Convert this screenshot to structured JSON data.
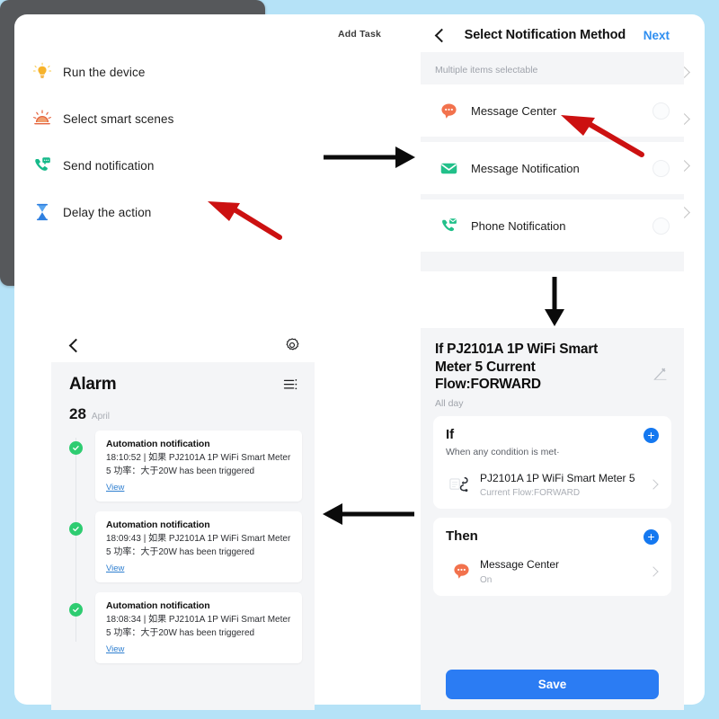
{
  "background_color": "#b5e2f7",
  "panel1": {
    "name": "Add Task",
    "title": "Add Task",
    "bezel_color": "#56585b",
    "items": [
      {
        "label": "Run the device",
        "icon": "lightbulb-icon",
        "color": "#f5a623"
      },
      {
        "label": "Select smart scenes",
        "icon": "sunrise-scene-icon",
        "color": "#ef6a4a"
      },
      {
        "label": "Send notification",
        "icon": "phone-message-icon",
        "color": "#16b98a"
      },
      {
        "label": "Delay the action",
        "icon": "hourglass-icon",
        "color": "#2f7fe0"
      }
    ]
  },
  "panel2": {
    "name": "Select Notification Method",
    "title": "Select Notification Method",
    "back_label": "back",
    "next_label": "Next",
    "subtitle": "Multiple items selectable",
    "methods": [
      {
        "label": "Message Center",
        "icon": "speech-bubble-icon",
        "color": "#f2724d",
        "selected": false
      },
      {
        "label": "Message Notification",
        "icon": "envelope-icon",
        "color": "#22c08a",
        "selected": false
      },
      {
        "label": "Phone Notification",
        "icon": "phone-envelope-icon",
        "color": "#22c08a",
        "selected": false
      }
    ]
  },
  "panel3": {
    "name": "Automation Detail",
    "title": "If PJ2101A 1P WiFi Smart Meter  5 Current Flow:FORWARD",
    "schedule": "All day",
    "edit_icon": "pencil-icon",
    "if_section": {
      "heading": "If",
      "subtitle": "When any condition is met·",
      "add_label": "+",
      "item": {
        "title": "PJ2101A 1P WiFi Smart Meter 5",
        "subtitle": "Current Flow:FORWARD",
        "icon": "smart-meter-icon"
      }
    },
    "then_section": {
      "heading": "Then",
      "add_label": "+",
      "item": {
        "title": "Message Center",
        "subtitle": "On",
        "icon": "speech-bubble-icon"
      }
    },
    "save_label": "Save",
    "save_color": "#2b7cf3"
  },
  "panel4": {
    "name": "Alarm",
    "back_label": "back",
    "settings_icon": "gear-icon",
    "title": "Alarm",
    "filter_icon": "list-filter-icon",
    "date_number": "28",
    "date_month": "April",
    "notifications": [
      {
        "title": "Automation notification",
        "body": "18:10:52 | 如果 PJ2101A 1P WiFi Smart Meter  5 功率：大于20W has been triggered",
        "link": "View",
        "status": "success"
      },
      {
        "title": "Automation notification",
        "body": "18:09:43 | 如果 PJ2101A 1P WiFi Smart Meter  5 功率：大于20W has been triggered",
        "link": "View",
        "status": "success"
      },
      {
        "title": "Automation notification",
        "body": "18:08:34 | 如果 PJ2101A 1P WiFi Smart Meter  5 功率：大于20W has been triggered",
        "link": "View",
        "status": "success"
      }
    ]
  },
  "flow_arrows": [
    {
      "name": "arrow-p1-to-p2",
      "direction": "right"
    },
    {
      "name": "arrow-p2-to-p3",
      "direction": "down"
    },
    {
      "name": "arrow-p3-to-p4",
      "direction": "left"
    }
  ],
  "callout_arrows": [
    {
      "name": "red-arrow-send-notification",
      "target": "Send notification"
    },
    {
      "name": "red-arrow-message-center",
      "target": "Message Center"
    }
  ]
}
